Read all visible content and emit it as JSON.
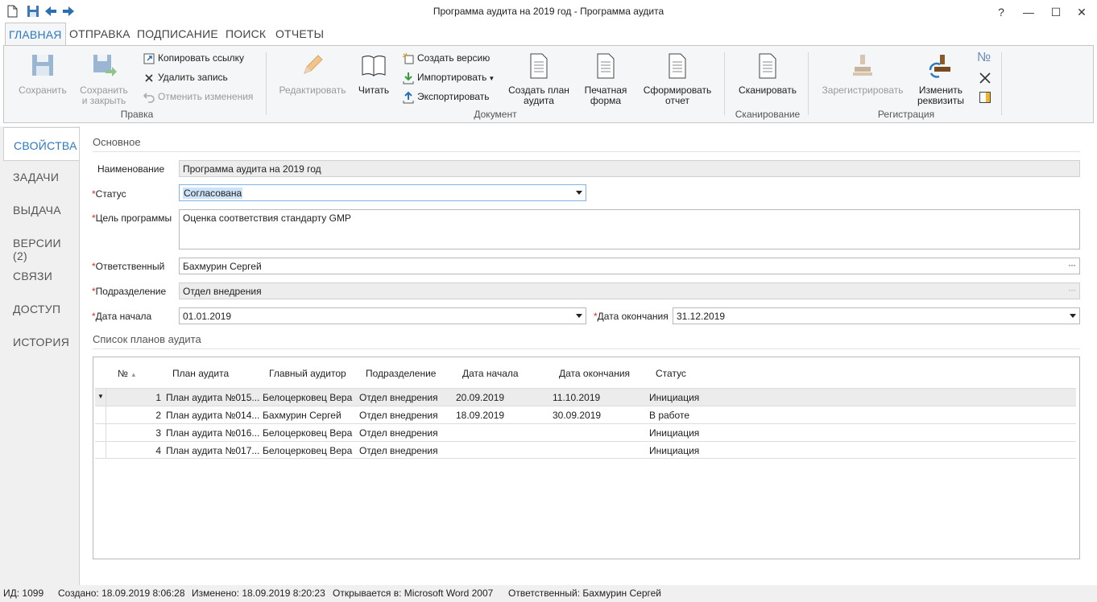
{
  "window": {
    "title": "Программа аудита на 2019 год - Программа аудита",
    "help": "?",
    "minimize": "—",
    "maximize": "☐",
    "close": "✕"
  },
  "menu_tabs": [
    "ГЛАВНАЯ",
    "ОТПРАВКА",
    "ПОДПИСАНИЕ",
    "ПОИСК",
    "ОТЧЕТЫ"
  ],
  "ribbon": {
    "save": "Сохранить",
    "save_close_1": "Сохранить",
    "save_close_2": "и закрыть",
    "copy_link": "Копировать ссылку",
    "delete_record": "Удалить запись",
    "cancel_changes": "Отменить изменения",
    "group_edit": "Правка",
    "edit": "Редактировать",
    "read": "Читать",
    "create_version": "Создать версию",
    "import": "Импортировать",
    "export": "Экспортировать",
    "create_plan_1": "Создать план",
    "create_plan_2": "аудита",
    "print_form_1": "Печатная",
    "print_form_2": "форма",
    "make_report_1": "Сформировать",
    "make_report_2": "отчет",
    "group_document": "Документ",
    "scan": "Сканировать",
    "group_scan": "Сканирование",
    "register": "Зарегистрировать",
    "change_req_1": "Изменить",
    "change_req_2": "реквизиты",
    "number_sign": "№",
    "group_registration": "Регистрация"
  },
  "sidenav": [
    "СВОЙСТВА",
    "ЗАДАЧИ",
    "ВЫДАЧА",
    "ВЕРСИИ (2)",
    "СВЯЗИ",
    "ДОСТУП",
    "ИСТОРИЯ"
  ],
  "form": {
    "section_main": "Основное",
    "name_label": "Наименование",
    "name_value": "Программа аудита на 2019 год",
    "req_mark": "*",
    "status_label": "Статус",
    "status_value": "Согласована",
    "goal_label": "Цель программы",
    "goal_value": "Оценка соответствия стандарту GMP",
    "resp_label": "Ответственный",
    "resp_value": "Бахмурин Сергей",
    "dept_label": "Подразделение",
    "dept_value": "Отдел внедрения",
    "start_label": "Дата начала",
    "start_value": "01.01.2019",
    "end_label": "Дата окончания",
    "end_value": "31.12.2019",
    "ellipsis": "···"
  },
  "plans": {
    "section": "Список планов аудита",
    "columns": [
      "№",
      "План аудита",
      "Главный аудитор",
      "Подразделение",
      "Дата начала",
      "Дата окончания",
      "Статус"
    ],
    "rows": [
      [
        "1",
        "План аудита №015...",
        "Белоцерковец Вера",
        "Отдел внедрения",
        "20.09.2019",
        "11.10.2019",
        "Инициация"
      ],
      [
        "2",
        "План аудита №014...",
        "Бахмурин Сергей",
        "Отдел внедрения",
        "18.09.2019",
        "30.09.2019",
        "В работе"
      ],
      [
        "3",
        "План аудита №016...",
        "Белоцерковец Вера",
        "Отдел внедрения",
        "",
        "",
        "Инициация"
      ],
      [
        "4",
        "План аудита №017...",
        "Белоцерковец Вера",
        "Отдел внедрения",
        "",
        "",
        "Инициация"
      ]
    ]
  },
  "status": {
    "id": "ИД: 1099",
    "created": "Создано: 18.09.2019 8:06:28",
    "modified": "Изменено: 18.09.2019 8:20:23",
    "opens_in": "Открывается в: Microsoft Word 2007",
    "responsible": "Ответственный: Бахмурин Сергей"
  },
  "colors": {
    "accent": "#2b79c2",
    "required": "#d0312d"
  }
}
